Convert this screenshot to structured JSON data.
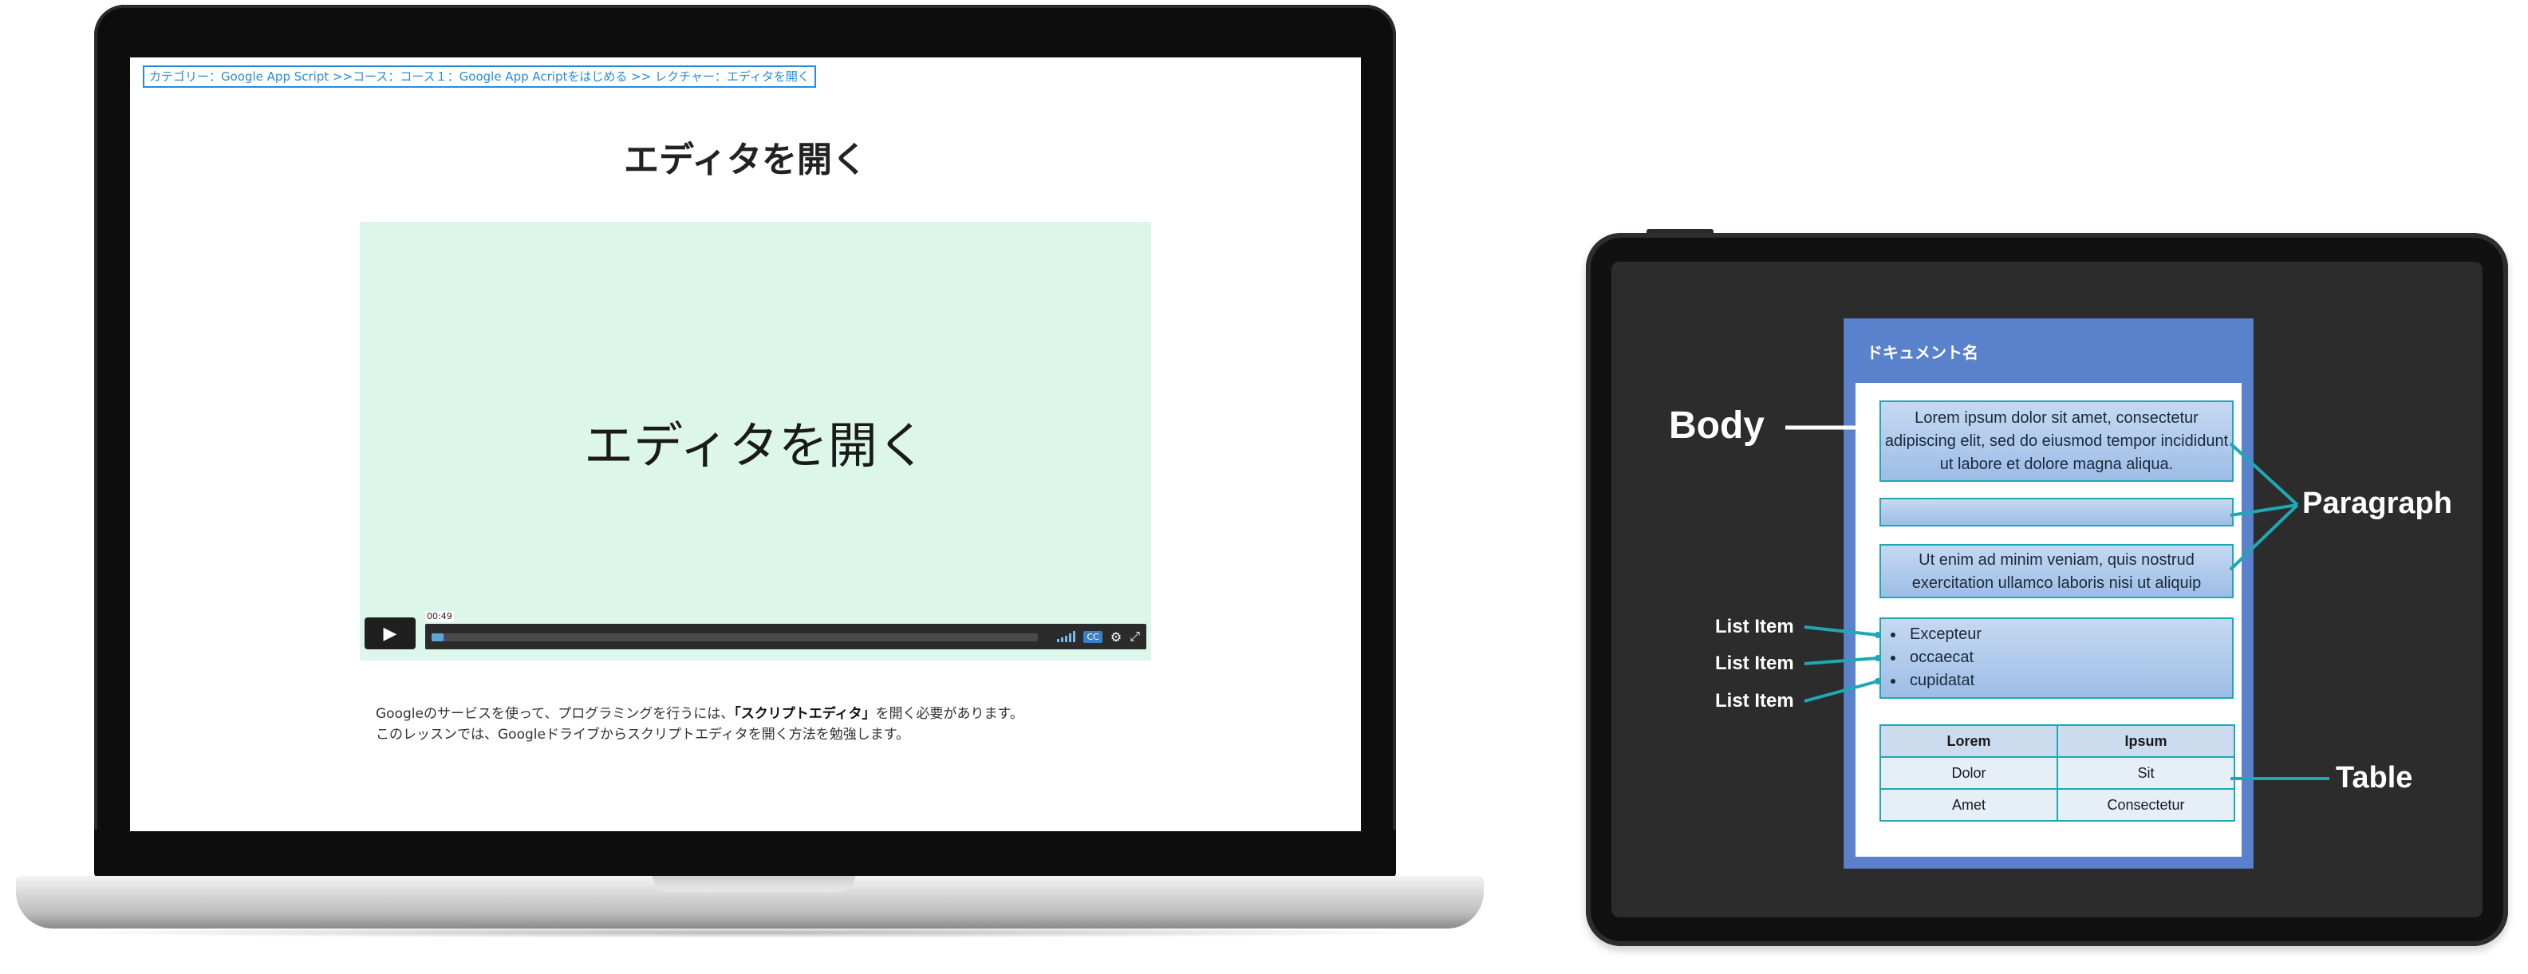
{
  "laptop": {
    "breadcrumb": "カテゴリー：Google App Script >>コース：コース１：Google App Acriptをはじめる >> レクチャー：エディタを開く",
    "page_title": "エディタを開く",
    "video": {
      "title": "エディタを開く",
      "timecode": "00:49",
      "progress": 0.02,
      "cc_label": "CC"
    },
    "description": {
      "line1_prefix": "Googleのサービスを使って、プログラミングを行うには、",
      "line1_bold": "「スクリプトエディタ」",
      "line1_suffix": "を開く必要があります。",
      "line2": "このレッスンでは、Googleドライブからスクリプトエディタを開く方法を勉強します。"
    }
  },
  "tablet": {
    "doc_name": "ドキュメント名",
    "paragraph1": "Lorem ipsum dolor sit amet, consectetur adipiscing elit, sed do eiusmod tempor incididunt ut labore et dolore magna aliqua.",
    "paragraph2": "",
    "paragraph3": "Ut enim ad minim veniam, quis nostrud exercitation ullamco laboris nisi ut aliquip",
    "list_items": [
      "Excepteur",
      "occaecat",
      "cupidatat"
    ],
    "table": {
      "headers": [
        "Lorem",
        "Ipsum"
      ],
      "rows": [
        [
          "Dolor",
          "Sit"
        ],
        [
          "Amet",
          "Consectetur"
        ]
      ]
    },
    "callouts": {
      "body": "Body",
      "paragraph": "Paragraph",
      "list_item_1": "List Item",
      "list_item_2": "List Item",
      "list_item_3": "List Item",
      "table": "Table"
    },
    "leader_color": "#1ea8b5"
  }
}
